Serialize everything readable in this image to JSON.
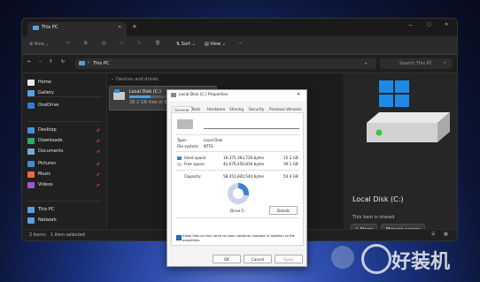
{
  "window": {
    "tab_title": "This PC",
    "new_tab": "+",
    "minimize": "—",
    "maximize": "▢",
    "close": "✕"
  },
  "toolbar": {
    "new_label": "New",
    "sort_label": "Sort",
    "view_label": "View",
    "more": "···"
  },
  "address": {
    "path": "This PC",
    "search_placeholder": "Search This PC"
  },
  "sidebar": {
    "items": [
      {
        "label": "Home",
        "icon": "home-icon",
        "color": "#e8e8e8"
      },
      {
        "label": "Gallery",
        "icon": "gallery-icon",
        "color": "#5aa0e6"
      },
      {
        "label": "OneDrive",
        "icon": "cloud-icon",
        "color": "#2f7ed8"
      },
      {
        "label": "Desktop",
        "icon": "desktop-icon",
        "color": "#4a8fd9"
      },
      {
        "label": "Downloads",
        "icon": "download-icon",
        "color": "#2fa86b"
      },
      {
        "label": "Documents",
        "icon": "document-icon",
        "color": "#7aa7d9"
      },
      {
        "label": "Pictures",
        "icon": "pictures-icon",
        "color": "#3b8fd6"
      },
      {
        "label": "Music",
        "icon": "music-icon",
        "color": "#e86a4a"
      },
      {
        "label": "Videos",
        "icon": "video-icon",
        "color": "#9a5ad6"
      },
      {
        "label": "This PC",
        "icon": "pc-icon",
        "color": "#5aa0e6"
      },
      {
        "label": "Network",
        "icon": "network-icon",
        "color": "#5aa0e6"
      }
    ]
  },
  "content": {
    "group_label": "Devices and drives",
    "drive_name": "Local Disk (C:)",
    "drive_free": "38.2 GB free of 64.4"
  },
  "details": {
    "title": "Local Disk (C:)",
    "shared_text": "This item is shared",
    "share_button": "Share",
    "manage_button": "Manage access"
  },
  "status": {
    "items": "2 items",
    "selected": "1 item selected"
  },
  "dialog": {
    "title": "Local Disk (C:) Properties",
    "tabs": [
      "General",
      "Tools",
      "Hardware",
      "Sharing",
      "Security",
      "Previous Versions"
    ],
    "type_label": "Type:",
    "type_value": "Local Disk",
    "fs_label": "File system:",
    "fs_value": "NTFS",
    "used_label": "Used space:",
    "used_bytes": "16,375,363,720 bytes",
    "used_gb": "15.2 GB",
    "free_label": "Free space:",
    "free_bytes": "42,076,450,816 bytes",
    "free_gb": "39.1 GB",
    "capacity_label": "Capacity:",
    "capacity_bytes": "58,451,820,544 bytes",
    "capacity_gb": "54.4 GB",
    "drive_label": "Drive C:",
    "cleanup_button": "Details",
    "index_text": "Allow files on this drive to have contents indexed in addition to file properties",
    "ok": "OK",
    "cancel": "Cancel",
    "apply": "Apply",
    "used_fraction": 0.28,
    "colors": {
      "used": "#3a84c9",
      "free": "#c7d6e8"
    }
  },
  "watermark": {
    "text": "好装机"
  }
}
